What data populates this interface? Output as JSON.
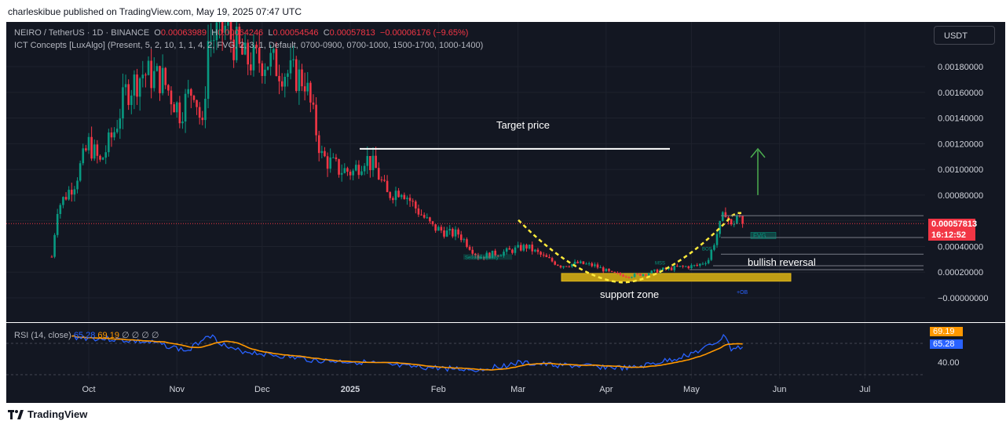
{
  "header": {
    "published_line": "charleskibue published on TradingView.com, May 19, 2025 07:47 UTC"
  },
  "legend": {
    "symbol": "NEIRO / TetherUS · 1D · BINANCE",
    "open_label": "O",
    "open": "0.00063989",
    "high_label": "H",
    "high": "0.00064246",
    "low_label": "L",
    "low": "0.00054546",
    "close_label": "C",
    "close": "0.00057813",
    "change": "−0.00006176 (−9.65%)",
    "indicator": "ICT Concepts [LuxAlgo] (Present, 5, 2, 10, 1, 1, 4, 2, FVG, 2, 3, 1, Default, 0700-0900, 0700-1000, 1500-1700, 1000-1400)"
  },
  "currency_button": "USDT",
  "price_axis": {
    "ticks": [
      "0.00180000",
      "0.00160000",
      "0.00140000",
      "0.00120000",
      "0.00100000",
      "0.00080000",
      "0.00040000",
      "0.00020000",
      "−0.00000000"
    ],
    "last_price": "0.00057813",
    "countdown": "16:12:52"
  },
  "time_axis": {
    "ticks": [
      "Oct",
      "Nov",
      "Dec",
      "2025",
      "Feb",
      "Mar",
      "Apr",
      "May",
      "Jun",
      "Jul"
    ]
  },
  "annotations": {
    "target_price": "Target price",
    "bullish_reversal": "bullish reversal",
    "support_zone": "support zone",
    "fvg_label": "FVG",
    "mss_label": "MSS",
    "bos_label": "BOS",
    "ob_label": "+OB",
    "liquidity_label": "Sellside liquidity"
  },
  "rsi": {
    "title": "RSI (14, close)",
    "rsi_value": "65.28",
    "ma_value": "69.19",
    "placeholders": "∅ ∅ ∅ ∅",
    "axis_tick": "40.00",
    "tag_ma": "69.19",
    "tag_rsi": "65.28"
  },
  "footer": {
    "brand": "TradingView"
  },
  "colors": {
    "up": "#089981",
    "down": "#f23645",
    "rsi_line": "#2962ff",
    "rsi_ma": "#ff9800",
    "arrow": "#4caf50",
    "curve": "#ffeb3b",
    "zone": "#c8a415"
  },
  "chart_data": {
    "type": "candlestick",
    "symbol": "NEIRO / TetherUS",
    "interval": "1D",
    "x_range": [
      "Sep 2024",
      "Jul 2025"
    ],
    "ylim": [
      -0.0001,
      0.0021
    ],
    "anchors": [
      {
        "date": "Sep 18",
        "close": 0.00032
      },
      {
        "date": "Sep 20",
        "close": 0.0007
      },
      {
        "date": "Sep 26",
        "close": 0.0009
      },
      {
        "date": "Oct 1",
        "close": 0.0012
      },
      {
        "date": "Oct 5",
        "close": 0.00105
      },
      {
        "date": "Oct 10",
        "close": 0.0013
      },
      {
        "date": "Oct 14",
        "close": 0.0016
      },
      {
        "date": "Oct 20",
        "close": 0.00175
      },
      {
        "date": "Oct 27",
        "close": 0.0017
      },
      {
        "date": "Nov 2",
        "close": 0.00145
      },
      {
        "date": "Nov 7",
        "close": 0.00165
      },
      {
        "date": "Nov 10",
        "close": 0.0013
      },
      {
        "date": "Nov 12",
        "close": 0.002
      },
      {
        "date": "Nov 18",
        "close": 0.0021
      },
      {
        "date": "Nov 25",
        "close": 0.00185
      },
      {
        "date": "Dec 3",
        "close": 0.00185
      },
      {
        "date": "Dec 10",
        "close": 0.00175
      },
      {
        "date": "Dec 16",
        "close": 0.0017
      },
      {
        "date": "Dec 22",
        "close": 0.0011
      },
      {
        "date": "Dec 28",
        "close": 0.001
      },
      {
        "date": "Jan 2",
        "close": 0.00098
      },
      {
        "date": "Jan 6",
        "close": 0.0011
      },
      {
        "date": "Jan 10",
        "close": 0.001
      },
      {
        "date": "Jan 14",
        "close": 0.0008
      },
      {
        "date": "Jan 19",
        "close": 0.00085
      },
      {
        "date": "Jan 24",
        "close": 0.0007
      },
      {
        "date": "Jan 30",
        "close": 0.00055
      },
      {
        "date": "Feb 5",
        "close": 0.0005
      },
      {
        "date": "Feb 8",
        "close": 0.0005
      },
      {
        "date": "Feb 12",
        "close": 0.0004
      },
      {
        "date": "Feb 15",
        "close": 0.00032
      },
      {
        "date": "Feb 25",
        "close": 0.00036
      },
      {
        "date": "Mar 4",
        "close": 0.0004
      },
      {
        "date": "Mar 10",
        "close": 0.00032
      },
      {
        "date": "Mar 16",
        "close": 0.00025
      },
      {
        "date": "Mar 22",
        "close": 0.00027
      },
      {
        "date": "Mar 28",
        "close": 0.00025
      },
      {
        "date": "Apr 3",
        "close": 0.00019
      },
      {
        "date": "Apr 9",
        "close": 0.00017
      },
      {
        "date": "Apr 15",
        "close": 0.00019
      },
      {
        "date": "Apr 21",
        "close": 0.00022
      },
      {
        "date": "Apr 27",
        "close": 0.00024
      },
      {
        "date": "May 3",
        "close": 0.00025
      },
      {
        "date": "May 7",
        "close": 0.0003
      },
      {
        "date": "May 10",
        "close": 0.0005
      },
      {
        "date": "May 13",
        "close": 0.00068
      },
      {
        "date": "May 15",
        "close": 0.00055
      },
      {
        "date": "May 17",
        "close": 0.00064
      },
      {
        "date": "May 19",
        "close": 0.00057813
      }
    ],
    "levels": {
      "target_price": 0.00116,
      "support_zone": [
        0.00013,
        0.00019
      ],
      "arrow_from": 0.0008,
      "arrow_to": 0.00116
    },
    "rsi": {
      "rsi": [
        {
          "date": "Sep 25",
          "value": 78
        },
        {
          "date": "Oct 10",
          "value": 75
        },
        {
          "date": "Oct 25",
          "value": 70
        },
        {
          "date": "Nov 5",
          "value": 60
        },
        {
          "date": "Nov 12",
          "value": 82
        },
        {
          "date": "Nov 20",
          "value": 62
        },
        {
          "date": "Dec 5",
          "value": 55
        },
        {
          "date": "Dec 20",
          "value": 48
        },
        {
          "date": "Jan 5",
          "value": 46
        },
        {
          "date": "Jan 20",
          "value": 40
        },
        {
          "date": "Feb 5",
          "value": 38
        },
        {
          "date": "Feb 15",
          "value": 36
        },
        {
          "date": "Mar 1",
          "value": 45
        },
        {
          "date": "Mar 15",
          "value": 42
        },
        {
          "date": "Mar 30",
          "value": 40
        },
        {
          "date": "Apr 10",
          "value": 38
        },
        {
          "date": "Apr 25",
          "value": 50
        },
        {
          "date": "May 5",
          "value": 62
        },
        {
          "date": "May 10",
          "value": 72
        },
        {
          "date": "May 13",
          "value": 80
        },
        {
          "date": "May 15",
          "value": 62
        },
        {
          "date": "May 19",
          "value": 65.28
        }
      ],
      "ma_last": 69.19
    }
  }
}
